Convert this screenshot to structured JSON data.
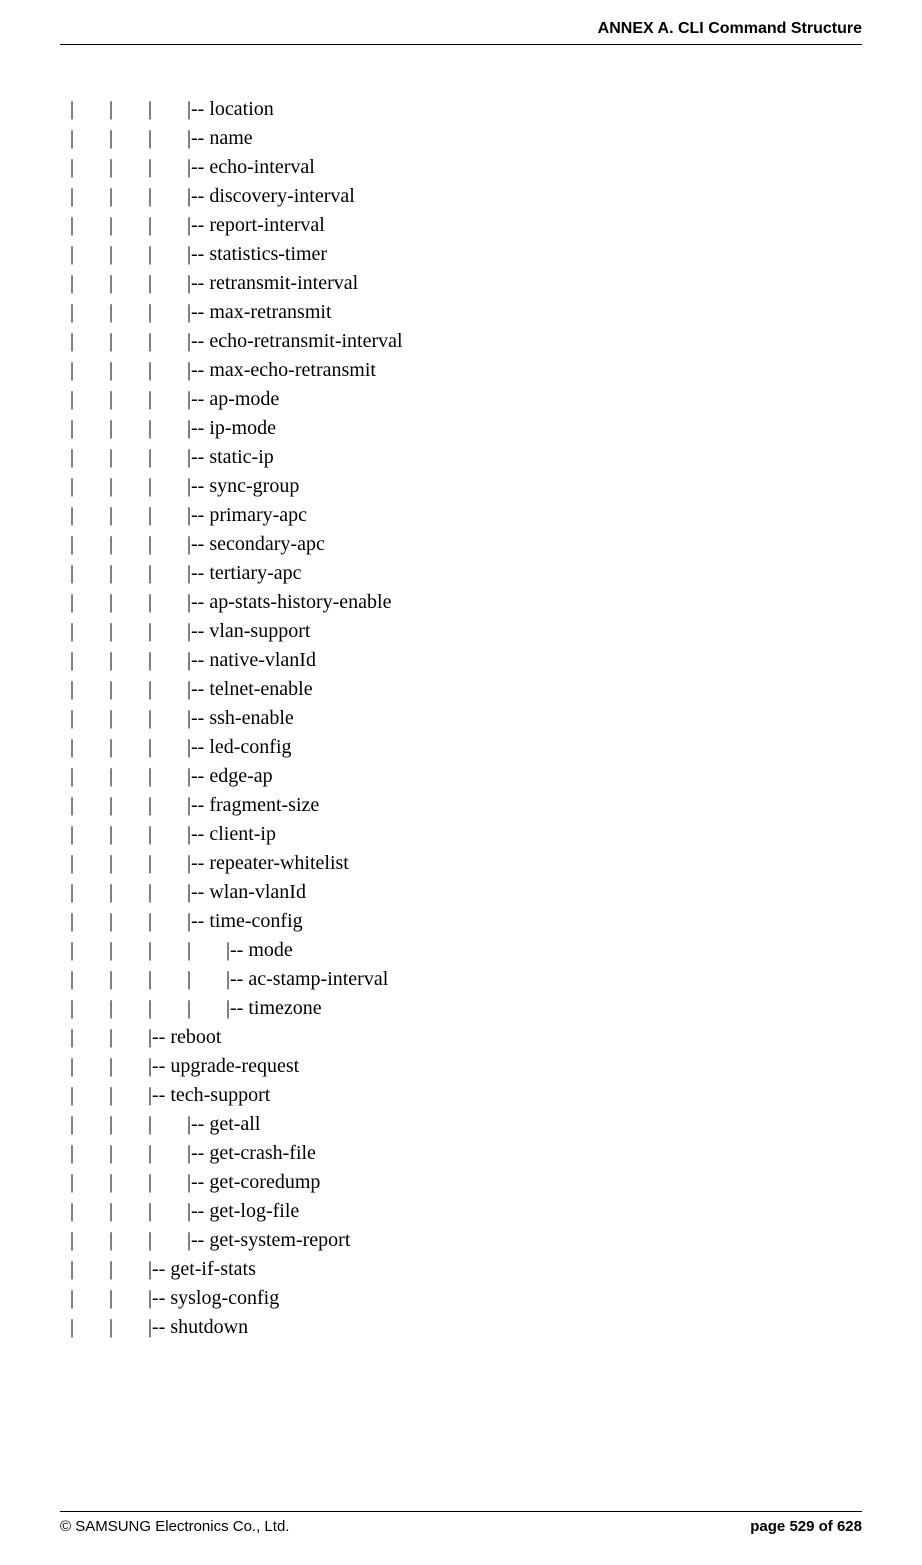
{
  "header": {
    "title": "ANNEX A. CLI Command Structure"
  },
  "tree": {
    "lines": [
      "|       |       |       |-- location",
      "|       |       |       |-- name",
      "|       |       |       |-- echo-interval",
      "|       |       |       |-- discovery-interval",
      "|       |       |       |-- report-interval",
      "|       |       |       |-- statistics-timer",
      "|       |       |       |-- retransmit-interval",
      "|       |       |       |-- max-retransmit",
      "|       |       |       |-- echo-retransmit-interval",
      "|       |       |       |-- max-echo-retransmit",
      "|       |       |       |-- ap-mode",
      "|       |       |       |-- ip-mode",
      "|       |       |       |-- static-ip",
      "|       |       |       |-- sync-group",
      "|       |       |       |-- primary-apc",
      "|       |       |       |-- secondary-apc",
      "|       |       |       |-- tertiary-apc",
      "|       |       |       |-- ap-stats-history-enable",
      "|       |       |       |-- vlan-support",
      "|       |       |       |-- native-vlanId",
      "|       |       |       |-- telnet-enable",
      "|       |       |       |-- ssh-enable",
      "|       |       |       |-- led-config",
      "|       |       |       |-- edge-ap",
      "|       |       |       |-- fragment-size",
      "|       |       |       |-- client-ip",
      "|       |       |       |-- repeater-whitelist",
      "|       |       |       |-- wlan-vlanId",
      "|       |       |       |-- time-config",
      "|       |       |       |       |-- mode",
      "|       |       |       |       |-- ac-stamp-interval",
      "|       |       |       |       |-- timezone",
      "|       |       |-- reboot",
      "|       |       |-- upgrade-request",
      "|       |       |-- tech-support",
      "|       |       |       |-- get-all",
      "|       |       |       |-- get-crash-file",
      "|       |       |       |-- get-coredump",
      "|       |       |       |-- get-log-file",
      "|       |       |       |-- get-system-report",
      "|       |       |-- get-if-stats",
      "|       |       |-- syslog-config",
      "|       |       |-- shutdown"
    ]
  },
  "footer": {
    "left": "© SAMSUNG Electronics Co., Ltd.",
    "right": "page 529 of 628"
  }
}
